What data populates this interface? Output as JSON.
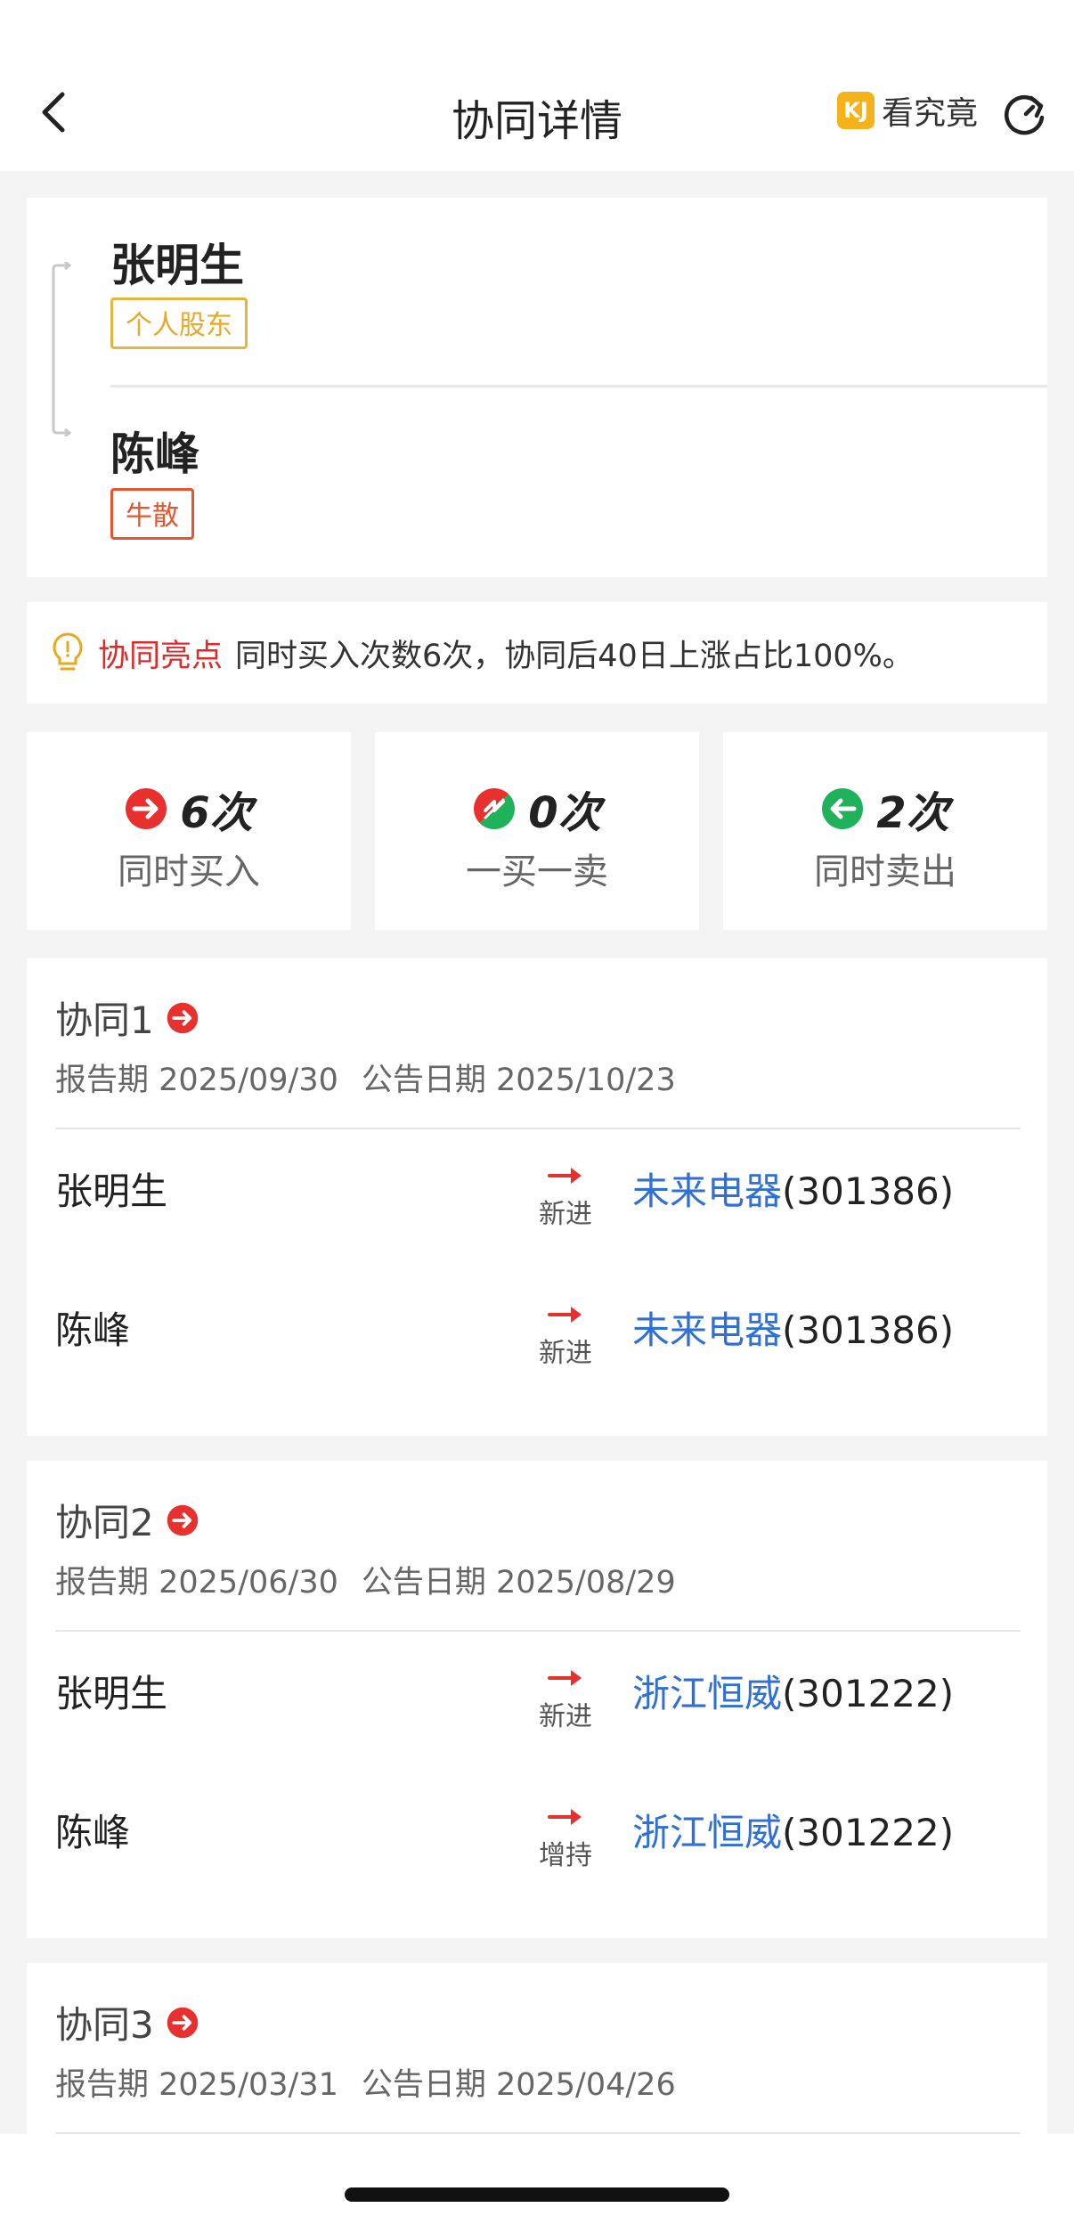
{
  "nav": {
    "title": "协同详情",
    "kan_logo": "KJ",
    "kan_label": "看究竟",
    "back_icon": "chevron-left-icon",
    "refresh_icon": "refresh-icon"
  },
  "people": [
    {
      "name": "张明生",
      "tag": "个人股东"
    },
    {
      "name": "陈峰",
      "tag": "牛散"
    }
  ],
  "highlight": {
    "label": "协同亮点",
    "text": "同时买入次数6次，协同后40日上涨占比100%。"
  },
  "stats": [
    {
      "count": "6次",
      "label": "同时买入"
    },
    {
      "count": "0次",
      "label": "一买一卖"
    },
    {
      "count": "2次",
      "label": "同时卖出"
    }
  ],
  "xietong": [
    {
      "title": "协同1",
      "report": "报告期 2025/09/30",
      "announce": "公告日期 2025/10/23",
      "rows": [
        {
          "name": "张明生",
          "action": "新进",
          "stock": "未来电器",
          "code": "(301386)"
        },
        {
          "name": "陈峰",
          "action": "新进",
          "stock": "未来电器",
          "code": "(301386)"
        }
      ]
    },
    {
      "title": "协同2",
      "report": "报告期 2025/06/30",
      "announce": "公告日期 2025/08/29",
      "rows": [
        {
          "name": "张明生",
          "action": "新进",
          "stock": "浙江恒威",
          "code": "(301222)"
        },
        {
          "name": "陈峰",
          "action": "增持",
          "stock": "浙江恒威",
          "code": "(301222)"
        }
      ]
    },
    {
      "title": "协同3",
      "report": "报告期 2025/03/31",
      "announce": "公告日期 2025/04/26",
      "rows": []
    }
  ],
  "colors": {
    "red": "#e8312f",
    "green": "#1fb25b",
    "link": "#2f6fd6",
    "tag_yellow": "#e6a92a",
    "tag_orange": "#e8542d"
  }
}
